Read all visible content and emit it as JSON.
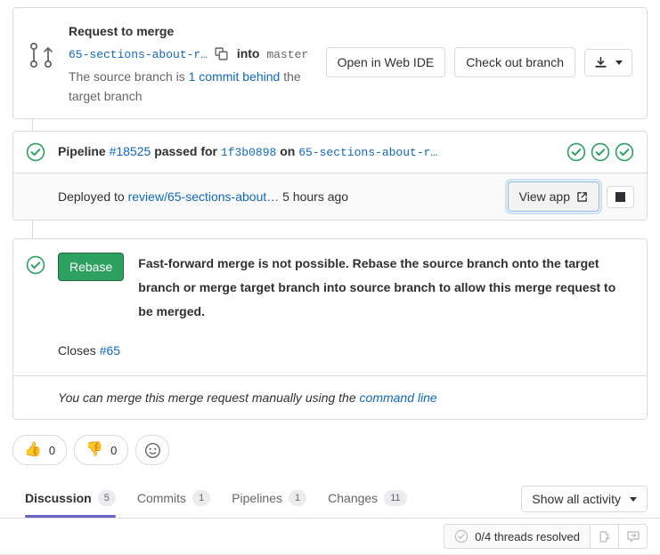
{
  "merge_request": {
    "title": "Request to merge",
    "source_branch": "65-sections-about-r…",
    "copy_icon": "copy-icon",
    "into_word": "into",
    "target_branch": "master",
    "behind_prefix": "The source branch is ",
    "behind_link": "1 commit behind",
    "behind_suffix": " the target branch",
    "actions": {
      "web_ide": "Open in Web IDE",
      "checkout": "Check out branch",
      "download_icon": "download-icon"
    }
  },
  "pipeline": {
    "status_icon": "status-success-icon",
    "label": "Pipeline",
    "pipeline_id": "#18525",
    "passed_word": "passed for",
    "commit_sha": "1f3b0898",
    "on_word": "on",
    "branch": "65-sections-about-r…",
    "stages": [
      "status-success-icon",
      "status-success-icon",
      "status-success-icon"
    ],
    "deploy": {
      "prefix": "Deployed to ",
      "environment": "review/65-sections-about…",
      "time": " 5 hours ago",
      "view_app_label": "View app",
      "external_link_icon": "external-link-icon",
      "stop_icon": "stop-square-icon"
    }
  },
  "rebase": {
    "status_icon": "status-success-icon",
    "button_label": "Rebase",
    "message": "Fast-forward merge is not possible. Rebase the source branch onto the target branch or merge target branch into source branch to allow this merge request to be merged.",
    "closes_label": "Closes ",
    "closes_issue": "#65",
    "manual_text": "You can merge this merge request manually using the ",
    "manual_link": "command line"
  },
  "reactions": [
    {
      "name": "thumbsup",
      "emoji": "👍",
      "count": "0"
    },
    {
      "name": "thumbsdown",
      "emoji": "👎",
      "count": "0"
    }
  ],
  "add_reaction_icon": "smiley-icon",
  "tabs": [
    {
      "label": "Discussion",
      "count": "5",
      "active": true
    },
    {
      "label": "Commits",
      "count": "1",
      "active": false
    },
    {
      "label": "Pipelines",
      "count": "1",
      "active": false
    },
    {
      "label": "Changes",
      "count": "11",
      "active": false
    }
  ],
  "activity_dropdown": {
    "label": "Show all activity",
    "chevron_icon": "chevron-down-icon"
  },
  "threads": {
    "status_icon": "check-circle-outline-icon",
    "label": "0/4 threads resolved",
    "prev_icon": "go-to-unresolved-icon",
    "next_icon": "jump-to-thread-icon"
  },
  "colors": {
    "success_green": "#2da160",
    "link_blue": "#1068bf",
    "tab_active": "#6666c4",
    "border": "#dbdbdb",
    "text": "#303030",
    "muted": "#666666"
  }
}
